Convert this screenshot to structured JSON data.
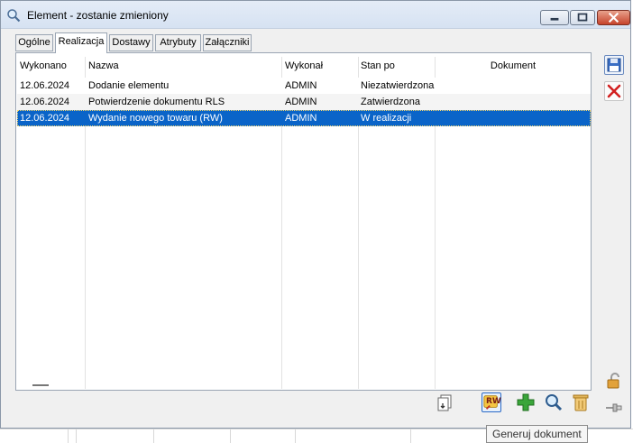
{
  "window": {
    "title": "Element - zostanie zmieniony"
  },
  "tabs": [
    {
      "label": "Ogólne",
      "active": false
    },
    {
      "label": "Realizacja",
      "active": true
    },
    {
      "label": "Dostawy",
      "active": false
    },
    {
      "label": "Atrybuty",
      "active": false
    },
    {
      "label": "Załączniki",
      "active": false
    }
  ],
  "table": {
    "columns": [
      "Wykonano",
      "Nazwa",
      "Wykonał",
      "Stan po",
      "Dokument"
    ],
    "rows": [
      {
        "date": "12.06.2024",
        "name": "Dodanie elementu",
        "by": "ADMIN",
        "state": "Niezatwierdzona",
        "doc": ""
      },
      {
        "date": "12.06.2024",
        "name": "Potwierdzenie dokumentu RLS",
        "by": "ADMIN",
        "state": "Zatwierdzona",
        "doc": ""
      },
      {
        "date": "12.06.2024",
        "name": "Wydanie nowego towaru (RW)",
        "by": "ADMIN",
        "state": "W realizacji",
        "doc": ""
      }
    ],
    "selected_row": 2
  },
  "toolbar": {
    "generate_label": "RW"
  },
  "tooltip": {
    "text": "Generuj dokument"
  },
  "colors": {
    "selection": "#0a64c8",
    "add_green": "#3aa53a",
    "cancel_red": "#d21f1f"
  },
  "icons": {
    "app": "magnifier-icon",
    "save": "floppy-disk-icon",
    "cancel": "red-x-icon",
    "docs": "documents-icon",
    "generate": "generate-document-icon",
    "add": "plus-icon",
    "search": "magnifier-icon",
    "delete": "trash-can-icon",
    "lock": "padlock-icon",
    "pin": "pin-icon"
  }
}
